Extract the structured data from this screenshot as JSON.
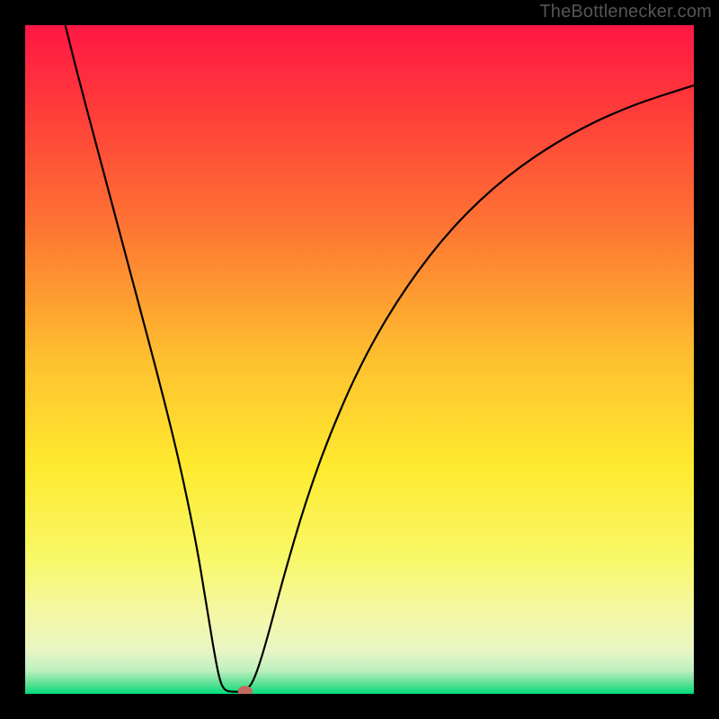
{
  "watermark": "TheBottlenecker.com",
  "chart_data": {
    "type": "line",
    "title": "",
    "xlabel": "",
    "ylabel": "",
    "xlim": [
      0,
      1
    ],
    "ylim": [
      0,
      1
    ],
    "background_gradient": {
      "stops": [
        {
          "offset": 0.0,
          "color": "#ff1745"
        },
        {
          "offset": 0.12,
          "color": "#ff3a3a"
        },
        {
          "offset": 0.3,
          "color": "#fe7433"
        },
        {
          "offset": 0.5,
          "color": "#fec02f"
        },
        {
          "offset": 0.66,
          "color": "#feea2f"
        },
        {
          "offset": 0.8,
          "color": "#f8f86a"
        },
        {
          "offset": 0.88,
          "color": "#f4f7a6"
        },
        {
          "offset": 0.935,
          "color": "#e9f6c4"
        },
        {
          "offset": 0.965,
          "color": "#bdf0c0"
        },
        {
          "offset": 0.985,
          "color": "#5be093"
        },
        {
          "offset": 1.0,
          "color": "#00dd7e"
        }
      ]
    },
    "series": [
      {
        "name": "bottleneck-curve",
        "stroke": "#000000",
        "points": [
          {
            "x": 0.06,
            "y": 1.0
          },
          {
            "x": 0.08,
            "y": 0.92
          },
          {
            "x": 0.12,
            "y": 0.77
          },
          {
            "x": 0.16,
            "y": 0.62
          },
          {
            "x": 0.2,
            "y": 0.47
          },
          {
            "x": 0.23,
            "y": 0.35
          },
          {
            "x": 0.255,
            "y": 0.23
          },
          {
            "x": 0.27,
            "y": 0.14
          },
          {
            "x": 0.283,
            "y": 0.06
          },
          {
            "x": 0.291,
            "y": 0.02
          },
          {
            "x": 0.298,
            "y": 0.005
          },
          {
            "x": 0.31,
            "y": 0.003
          },
          {
            "x": 0.322,
            "y": 0.003
          },
          {
            "x": 0.332,
            "y": 0.006
          },
          {
            "x": 0.343,
            "y": 0.022
          },
          {
            "x": 0.36,
            "y": 0.075
          },
          {
            "x": 0.385,
            "y": 0.17
          },
          {
            "x": 0.42,
            "y": 0.29
          },
          {
            "x": 0.46,
            "y": 0.4
          },
          {
            "x": 0.51,
            "y": 0.51
          },
          {
            "x": 0.57,
            "y": 0.61
          },
          {
            "x": 0.64,
            "y": 0.7
          },
          {
            "x": 0.72,
            "y": 0.775
          },
          {
            "x": 0.81,
            "y": 0.835
          },
          {
            "x": 0.9,
            "y": 0.878
          },
          {
            "x": 1.0,
            "y": 0.91
          }
        ]
      }
    ],
    "marker": {
      "x": 0.329,
      "y": 0.004,
      "rx": 0.011,
      "ry": 0.008,
      "fill": "#c36a5f"
    }
  }
}
